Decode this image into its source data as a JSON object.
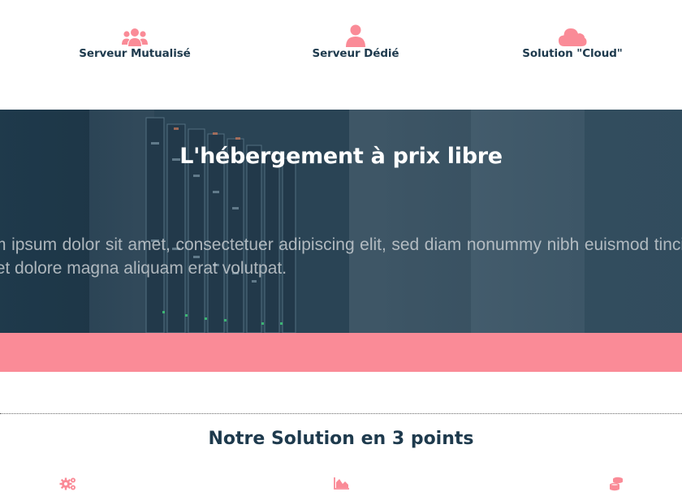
{
  "services": [
    {
      "label": "Serveur Mutualisé",
      "icon": "users-icon"
    },
    {
      "label": "Serveur Dédié",
      "icon": "user-icon"
    },
    {
      "label": "Solution \"Cloud\"",
      "icon": "cloud-icon"
    }
  ],
  "hero": {
    "title": "L'hébergement à prix libre",
    "text": "Lorem ipsum dolor sit amet, consectetuer adipiscing elit, sed diam nonummy nibh euismod tincidunt ut laoreet dolore magna aliquam erat volutpat."
  },
  "section": {
    "title": "Notre Solution en 3 points"
  },
  "points": [
    {
      "icon": "cogs-icon"
    },
    {
      "icon": "area-chart-icon"
    },
    {
      "icon": "coins-icon"
    }
  ],
  "colors": {
    "accent": "#fa8b97",
    "dark": "#1e3a4d"
  }
}
